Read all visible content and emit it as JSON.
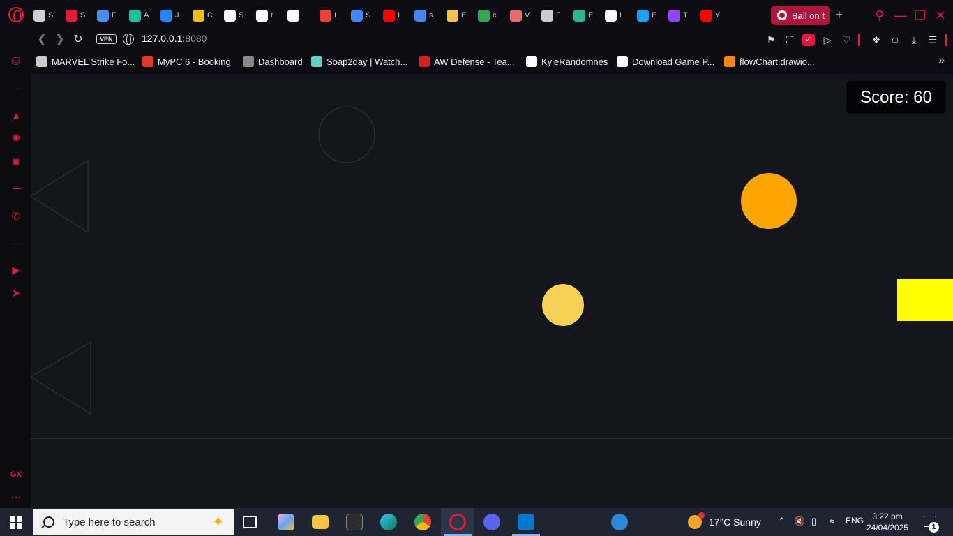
{
  "browser": {
    "tabs": [
      {
        "title": "S",
        "icon": "game-controller-icon",
        "color": "#d0d0d8"
      },
      {
        "title": "S",
        "icon": "swirl-icon",
        "color": "#e01b3c"
      },
      {
        "title": "F",
        "icon": "rocket-icon",
        "color": "#4a8cf0"
      },
      {
        "title": "A",
        "icon": "grammarly-icon",
        "color": "#15c39a"
      },
      {
        "title": "J",
        "icon": "jira-icon",
        "color": "#2684ff"
      },
      {
        "title": "C",
        "icon": "doc-icon",
        "color": "#fbbc04"
      },
      {
        "title": "S",
        "icon": "file-icon",
        "color": "#ffffff"
      },
      {
        "title": "r",
        "icon": "github-icon",
        "color": "#ffffff"
      },
      {
        "title": "L",
        "icon": "file-icon",
        "color": "#ffffff"
      },
      {
        "title": "I",
        "icon": "gmail-icon",
        "color": "#ea4335"
      },
      {
        "title": "S",
        "icon": "google-icon",
        "color": "#4285f4"
      },
      {
        "title": "I",
        "icon": "youtube-icon",
        "color": "#ff0000"
      },
      {
        "title": "s",
        "icon": "google-icon",
        "color": "#4285f4"
      },
      {
        "title": "E",
        "icon": "bear-icon",
        "color": "#f4c542"
      },
      {
        "title": "c",
        "icon": "colorful-bird-icon",
        "color": "#34a853"
      },
      {
        "title": "V",
        "icon": "jar-icon",
        "color": "#e86b6b"
      },
      {
        "title": "F",
        "icon": "wave-icon",
        "color": "#cccccc"
      },
      {
        "title": "E",
        "icon": "tt-icon",
        "color": "#27b996"
      },
      {
        "title": "L",
        "icon": "openai-icon",
        "color": "#ffffff"
      },
      {
        "title": "E",
        "icon": "bird-icon",
        "color": "#1ca0f2"
      },
      {
        "title": "T",
        "icon": "twitch-icon",
        "color": "#9146ff"
      },
      {
        "title": "Y",
        "icon": "youtube-icon",
        "color": "#ff0000"
      }
    ],
    "active_tab": {
      "title": "Ball on t",
      "icon": "twitch-icon",
      "color": "#9146ff"
    },
    "url_host": "127.0.0.1",
    "url_port": ":8080",
    "vpn_label": "VPN",
    "accent": "#e01b3c"
  },
  "bookmarks": [
    {
      "label": "MARVEL Strike Fo...",
      "icon": "marvel-icon",
      "color": "#cccccc"
    },
    {
      "label": "MyPC 6 - Booking",
      "icon": "timer-icon",
      "color": "#e23a2a"
    },
    {
      "label": "Dashboard",
      "icon": "dashboard-icon",
      "color": "#888888"
    },
    {
      "label": "Soap2day | Watch...",
      "icon": "tv-icon",
      "color": "#5fd3c7"
    },
    {
      "label": "AW Defense - Tea...",
      "icon": "mc-icon",
      "color": "#d42020"
    },
    {
      "label": "KyleRandomnes",
      "icon": "github-icon",
      "color": "#ffffff"
    },
    {
      "label": "Download Game P...",
      "icon": "wordpress-icon",
      "color": "#ffffff"
    },
    {
      "label": "flowChart.drawio...",
      "icon": "drawio-icon",
      "color": "#f08705"
    }
  ],
  "game": {
    "score_label": "Score: 60",
    "background": "#15151d"
  },
  "taskbar": {
    "search_placeholder": "Type here to search",
    "weather": "17°C  Sunny",
    "language": "ENG",
    "time": "3:22 pm",
    "date": "24/04/2025",
    "notifications": "1"
  }
}
